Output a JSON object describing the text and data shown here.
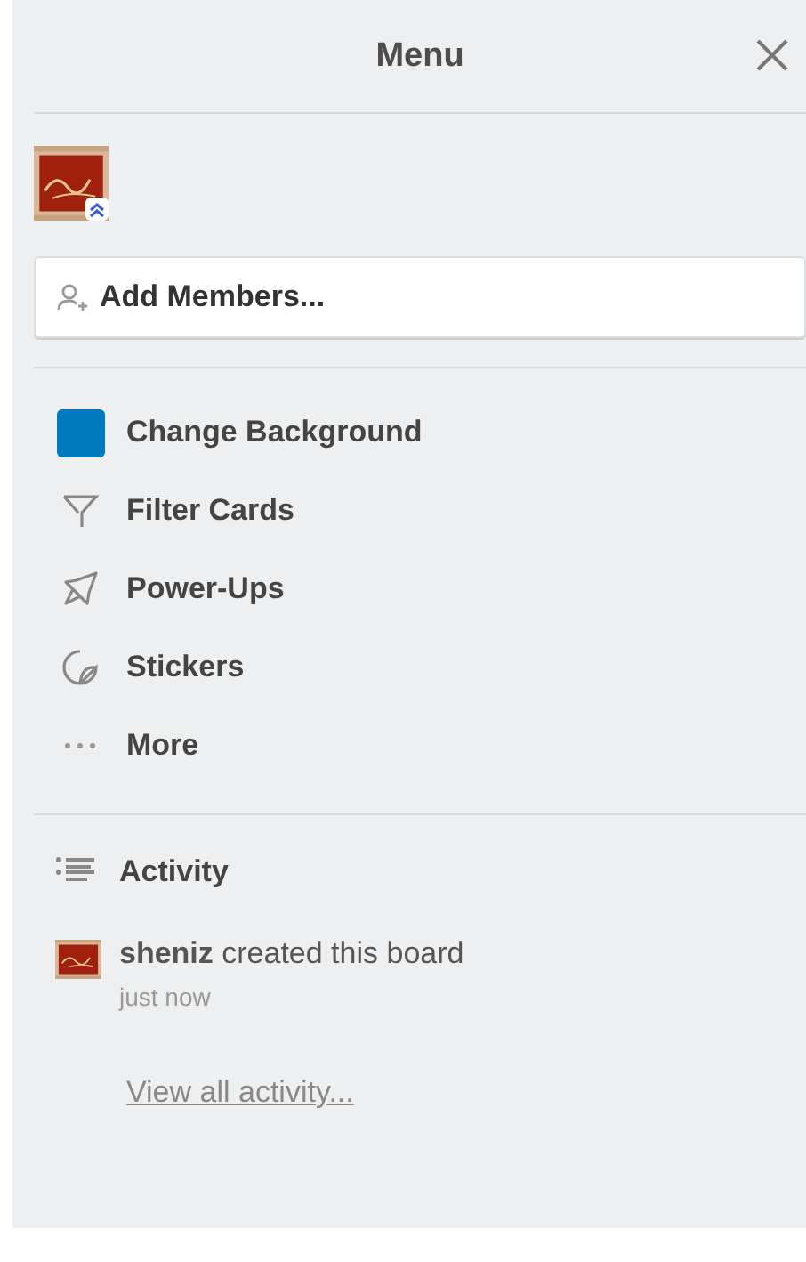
{
  "header": {
    "title": "Menu"
  },
  "add_members": {
    "label": "Add Members..."
  },
  "menu_items": [
    {
      "kind": "swatch",
      "label": "Change Background",
      "color": "#0079bf"
    },
    {
      "kind": "filter",
      "label": "Filter Cards"
    },
    {
      "kind": "rocket",
      "label": "Power-Ups"
    },
    {
      "kind": "sticker",
      "label": "Stickers"
    },
    {
      "kind": "more",
      "label": "More"
    }
  ],
  "activity": {
    "title": "Activity",
    "entries": [
      {
        "text": "**sheniz** created this board",
        "time": "just now"
      }
    ],
    "view_all": "View all activity..."
  }
}
